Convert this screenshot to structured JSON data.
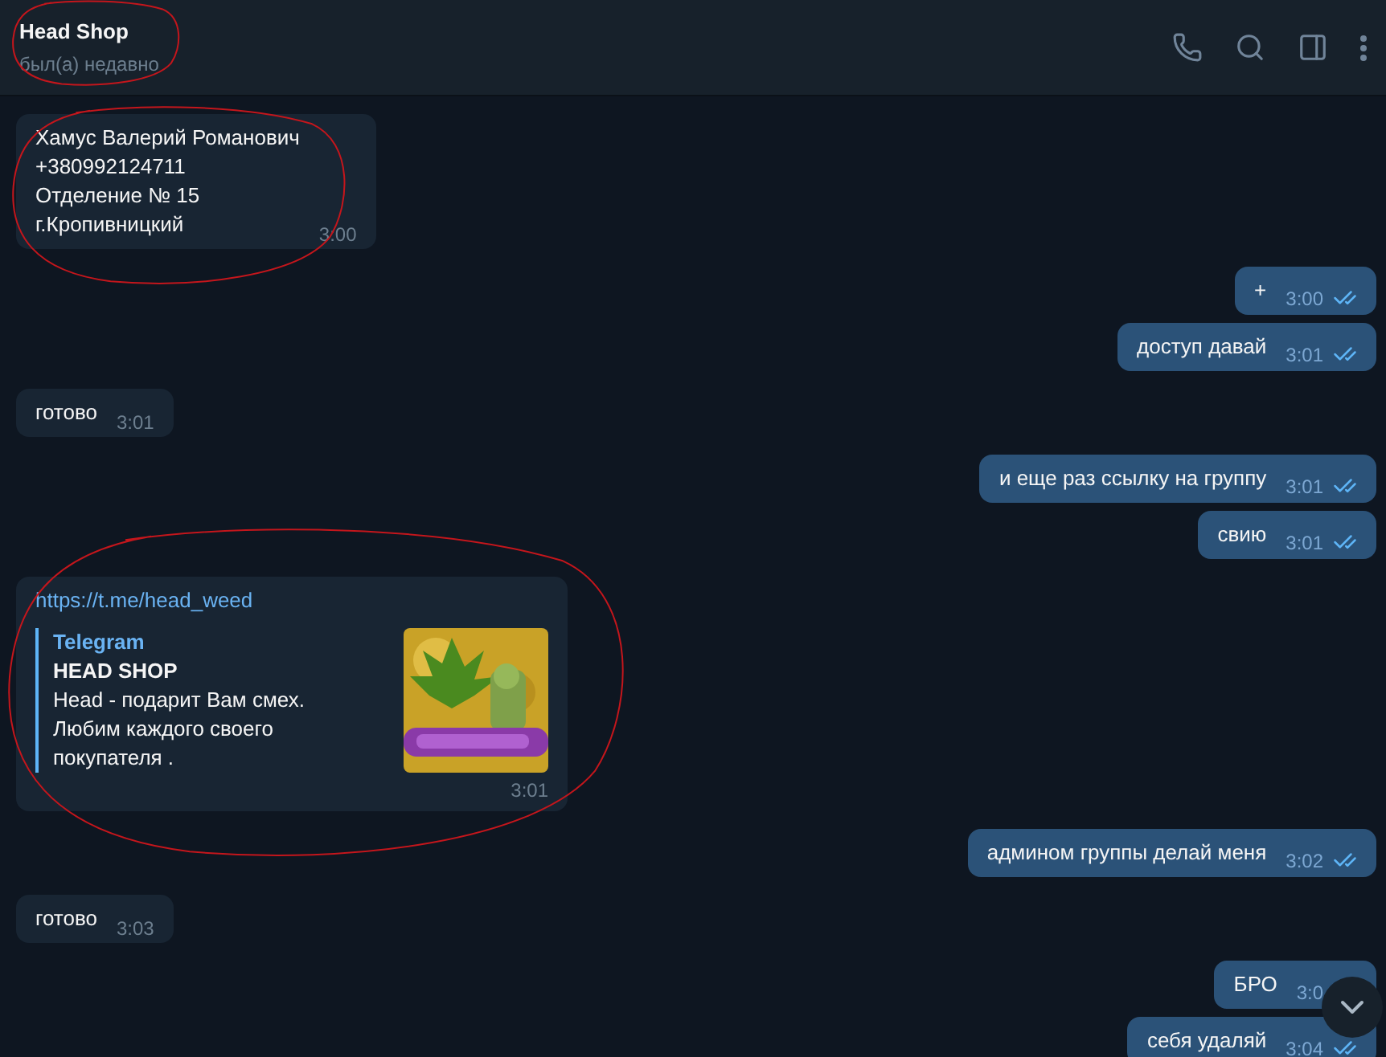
{
  "header": {
    "title": "Head Shop",
    "status": "был(а) недавно",
    "circled": true
  },
  "messages": [
    {
      "kind": "text",
      "outgoing": false,
      "text": "Хамус Валерий Романович\n+380992124711\nОтделение № 15\nг.Кропивницкий",
      "time": "3:00",
      "circled": true
    },
    {
      "kind": "text",
      "outgoing": true,
      "text": "+",
      "time": "3:00",
      "read": true
    },
    {
      "kind": "text",
      "outgoing": true,
      "text": "доступ давай",
      "time": "3:01",
      "read": true
    },
    {
      "kind": "text",
      "outgoing": false,
      "text": "готово",
      "time": "3:01"
    },
    {
      "kind": "text",
      "outgoing": true,
      "text": "и еще раз ссылку на группу",
      "time": "3:01",
      "read": true
    },
    {
      "kind": "text",
      "outgoing": true,
      "text": "свию",
      "time": "3:01",
      "read": true
    },
    {
      "kind": "link",
      "outgoing": false,
      "url": "https://t.me/head_weed",
      "preview": {
        "site": "Telegram",
        "title": "HEAD SHOP",
        "description": "Head - подарит Вам смех.\nЛюбим каждого своего покупателя ."
      },
      "time": "3:01",
      "circled": true
    },
    {
      "kind": "text",
      "outgoing": true,
      "text": "админом группы делай меня",
      "time": "3:02",
      "read": true
    },
    {
      "kind": "text",
      "outgoing": false,
      "text": "готово",
      "time": "3:03"
    },
    {
      "kind": "text",
      "outgoing": true,
      "text": "БРО",
      "time": "3:0"
    },
    {
      "kind": "text",
      "outgoing": true,
      "text": "себя удаляй",
      "time": "3:04",
      "read": true
    }
  ]
}
